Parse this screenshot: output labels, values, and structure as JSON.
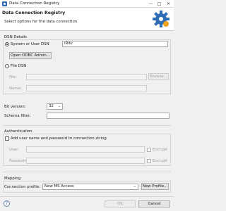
{
  "window": {
    "title": "Data Connection Registry",
    "minimize": "—",
    "maximize": "□",
    "close": "✕"
  },
  "header": {
    "title": "Data Connection Registry",
    "description": "Select options for the data connection."
  },
  "dsn_details": {
    "label": "DSN Details",
    "system_user_dsn": {
      "label": "System or User DSN",
      "value": "iRdv",
      "checked": true
    },
    "open_odbc_admin": "Open ODBC Admin...",
    "file_dsn": {
      "label": "File DSN",
      "file_label": "File:",
      "name_label": "Name:",
      "browse": "Browse...",
      "checked": false
    }
  },
  "bit_version": {
    "label": "Bit version:",
    "value": "32",
    "arrow": "⌄"
  },
  "schema_filter": {
    "label": "Schema filter:",
    "value": ""
  },
  "authentication": {
    "label": "Authentication",
    "add_user_label": "Add user name and password to connection string",
    "user_label": "User:",
    "password_label": "Password:",
    "encrypt_label": "Encrypt"
  },
  "mapping": {
    "label": "Mapping",
    "connection_profile_label": "Connection profile:",
    "connection_profile_value": "New MS Access",
    "new_profile": "New Profile...",
    "arrow": "⌄"
  },
  "footer": {
    "help": "?",
    "ok": "OK",
    "cancel": "Cancel"
  }
}
